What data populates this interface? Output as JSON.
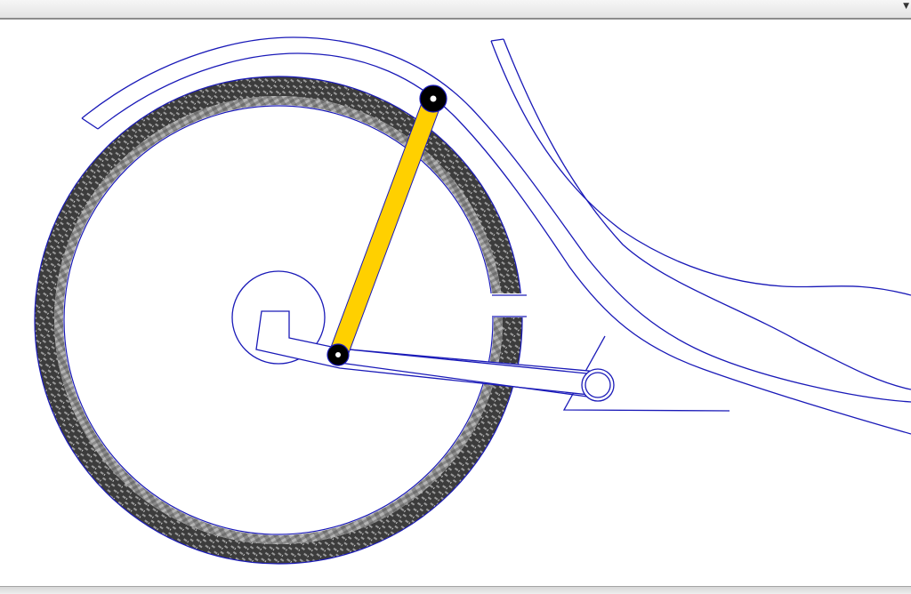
{
  "window": {
    "top_bar_arrow_icon": "chevron-down-icon"
  },
  "colors": {
    "line": "#1a1ab8",
    "crank_arm": "#ffd000",
    "pivot": "#000000",
    "tire_dark": "#3c3c3c",
    "tire_light": "#9a9a9a",
    "background": "#ffffff"
  }
}
